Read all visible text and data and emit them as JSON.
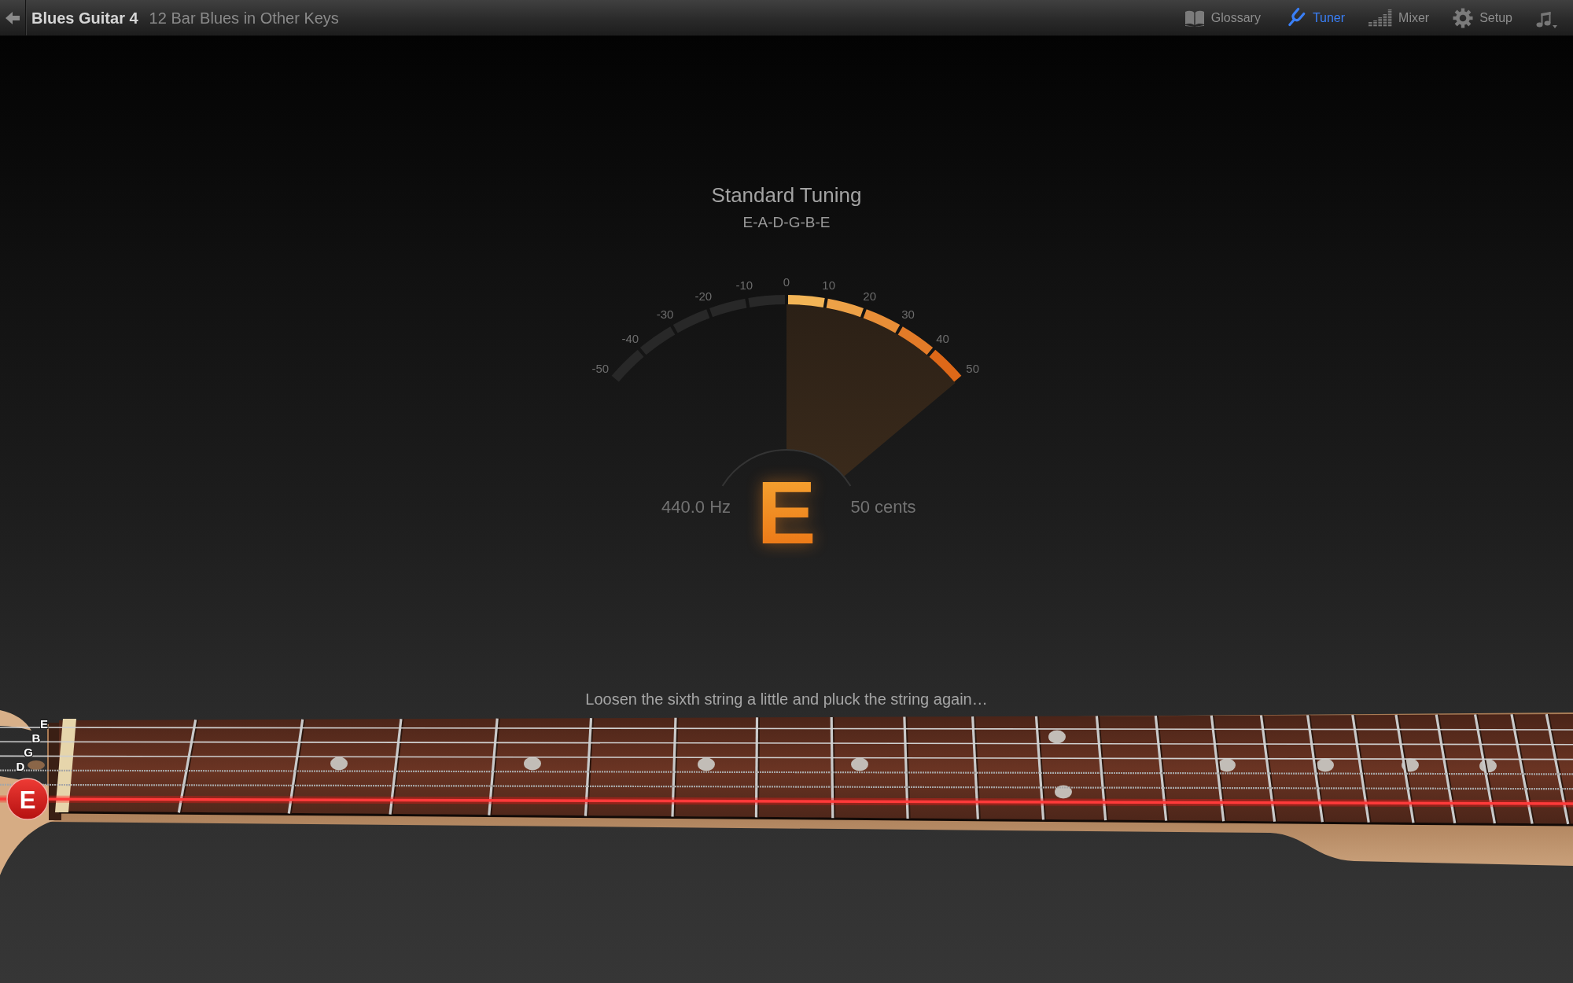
{
  "header": {
    "title": "Blues Guitar 4",
    "subtitle": "12 Bar Blues in Other Keys"
  },
  "nav": [
    {
      "label": "Glossary",
      "selected": false
    },
    {
      "label": "Tuner",
      "selected": true
    },
    {
      "label": "Mixer",
      "selected": false
    },
    {
      "label": "Setup",
      "selected": false
    }
  ],
  "tuner": {
    "title": "Standard Tuning",
    "tuning": "E-A-D-G-B-E",
    "scale": [
      "-50",
      "-40",
      "-30",
      "-20",
      "-10",
      "0",
      "10",
      "20",
      "30",
      "40",
      "50"
    ],
    "level": 0.5,
    "frequency": "440.0 Hz",
    "note": "E",
    "offset": "50 cents"
  },
  "instruction": "Loosen the sixth string a little and pluck the string again…",
  "strings": [
    {
      "label": "E",
      "selected": false
    },
    {
      "label": "B",
      "selected": false
    },
    {
      "label": "G",
      "selected": false
    },
    {
      "label": "D",
      "selected": false
    },
    {
      "selected": false
    },
    {
      "label": "E",
      "selected": true
    }
  ]
}
